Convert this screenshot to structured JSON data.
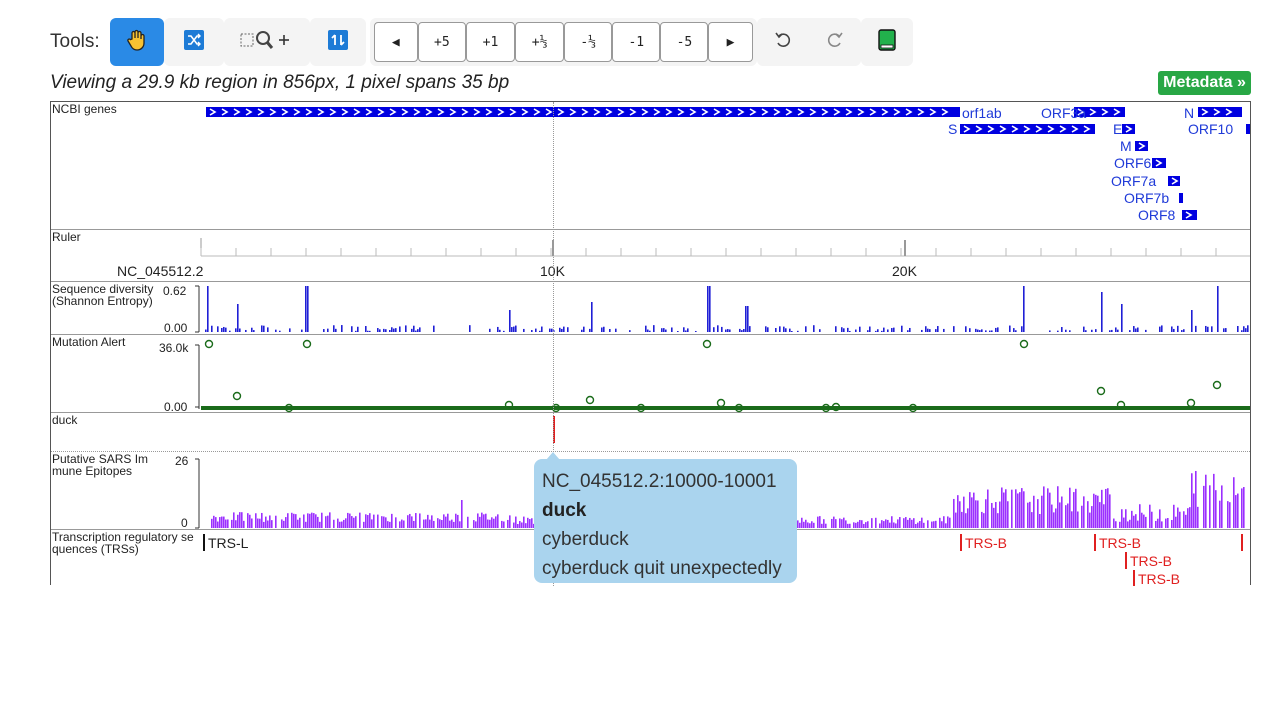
{
  "toolbar": {
    "label": "Tools:",
    "nav_buttons": [
      "◀",
      "+5",
      "+1",
      "+⅓",
      "-⅓",
      "-1",
      "-5",
      "▶"
    ]
  },
  "caption": "Viewing a 29.9 kb region in 856px, 1 pixel spans 35 bp",
  "metadata_label": "Metadata »",
  "tracks": {
    "genes": {
      "label": "NCBI genes",
      "names": {
        "orf1ab": "orf1ab",
        "orf3a": "ORF3a",
        "n": "N",
        "s": "S",
        "e": "E",
        "orf10": "ORF10",
        "m": "M",
        "orf6": "ORF6",
        "orf7a": "ORF7a",
        "orf7b": "ORF7b",
        "orf8": "ORF8"
      }
    },
    "ruler": {
      "label": "Ruler",
      "chrom": "NC_045512.2",
      "tick10k": "10K",
      "tick20k": "20K"
    },
    "diversity": {
      "label": "Sequence diversity\n(Shannon Entropy)",
      "ymax": "0.62",
      "ymin": "0.00"
    },
    "mutation": {
      "label": "Mutation Alert",
      "ymax": "36.0k",
      "ymin": "0.00"
    },
    "duck": {
      "label": "duck"
    },
    "epitopes": {
      "label": "Putative SARS Im\nmune Epitopes",
      "ymax": "26",
      "ymin": "0"
    },
    "trs": {
      "label": "Transcription regulatory se\nquences (TRSs)",
      "trs_l": "TRS-L",
      "trs_b": "TRS-B"
    }
  },
  "popup": {
    "position": "NC_045512.2:10000-10001",
    "name": "duck",
    "line1": "cyberduck",
    "line2": "cyberduck quit unexpectedly"
  },
  "colors": {
    "active_tool": "#2a8ae6",
    "gene": "#0000e0",
    "diversity": "#1f1fd6",
    "mutation": "#1a6b1a",
    "duck": "#e02020",
    "epitope": "#9b30ff",
    "trs_b": "#e02020",
    "metadata": "#28a745",
    "popup": "#aad4ee"
  }
}
